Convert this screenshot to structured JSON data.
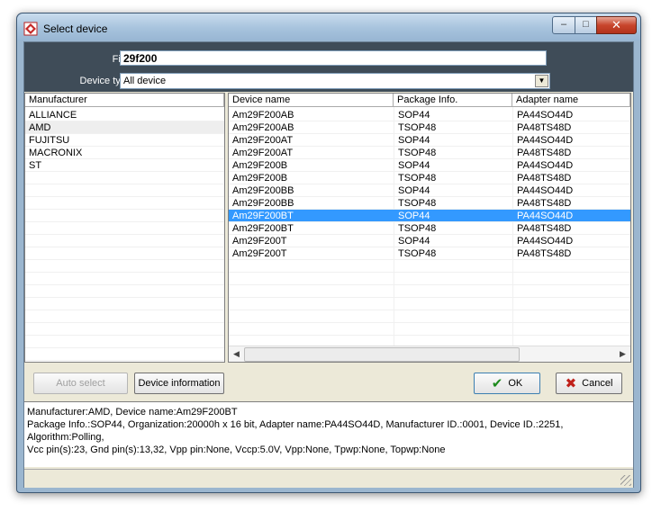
{
  "window": {
    "title": "Select device",
    "buttons": {
      "minimize": "‒",
      "maximize": "□",
      "close": "✕"
    }
  },
  "find": {
    "label": "Find",
    "value": "29f200"
  },
  "device_type": {
    "label": "Device type",
    "value": "All device"
  },
  "manufacturer_list": {
    "header": "Manufacturer",
    "items": [
      "ALLIANCE",
      "AMD",
      "FUJITSU",
      "MACRONIX",
      "ST"
    ],
    "selected": "AMD"
  },
  "device_list": {
    "headers": {
      "name": "Device name",
      "package": "Package Info.",
      "adapter": "Adapter name"
    },
    "rows": [
      {
        "name": "Am29F200AB",
        "package": "SOP44",
        "adapter": "PA44SO44D"
      },
      {
        "name": "Am29F200AB",
        "package": "TSOP48",
        "adapter": "PA48TS48D"
      },
      {
        "name": "Am29F200AT",
        "package": "SOP44",
        "adapter": "PA44SO44D"
      },
      {
        "name": "Am29F200AT",
        "package": "TSOP48",
        "adapter": "PA48TS48D"
      },
      {
        "name": "Am29F200B",
        "package": "SOP44",
        "adapter": "PA44SO44D"
      },
      {
        "name": "Am29F200B",
        "package": "TSOP48",
        "adapter": "PA48TS48D"
      },
      {
        "name": "Am29F200BB",
        "package": "SOP44",
        "adapter": "PA44SO44D"
      },
      {
        "name": "Am29F200BB",
        "package": "TSOP48",
        "adapter": "PA48TS48D"
      },
      {
        "name": "Am29F200BT",
        "package": "SOP44",
        "adapter": "PA44SO44D"
      },
      {
        "name": "Am29F200BT",
        "package": "TSOP48",
        "adapter": "PA48TS48D"
      },
      {
        "name": "Am29F200T",
        "package": "SOP44",
        "adapter": "PA44SO44D"
      },
      {
        "name": "Am29F200T",
        "package": "TSOP48",
        "adapter": "PA48TS48D"
      }
    ],
    "selected_index": 8
  },
  "buttons": {
    "auto_select": "Auto select",
    "device_information": "Device information",
    "ok": "OK",
    "cancel": "Cancel"
  },
  "info": {
    "line1": "Manufacturer:AMD, Device name:Am29F200BT",
    "line2": "Package Info.:SOP44, Organization:20000h x 16 bit, Adapter name:PA44SO44D, Manufacturer ID.:0001, Device ID.:2251, Algorithm:Polling,",
    "line3": "Vcc pin(s):23, Gnd pin(s):13,32, Vpp pin:None, Vccp:5.0V, Vpp:None, Tpwp:None, Topwp:None"
  }
}
